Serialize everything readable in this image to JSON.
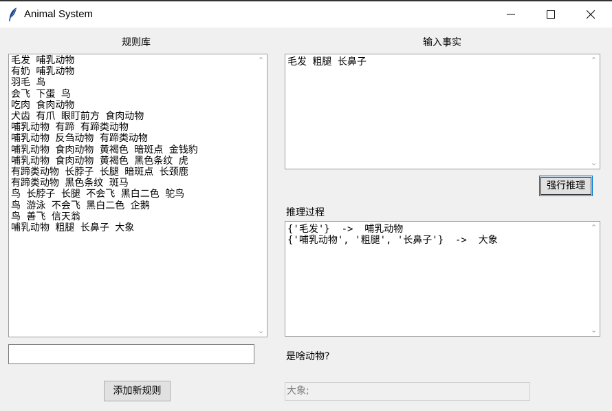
{
  "window": {
    "title": "Animal System"
  },
  "rules": {
    "label": "规则库",
    "lines": [
      "毛发 哺乳动物",
      "有奶 哺乳动物",
      "羽毛 鸟",
      "会飞 下蛋 鸟",
      "吃肉 食肉动物",
      "犬齿 有爪 眼盯前方 食肉动物",
      "哺乳动物 有蹄 有蹄类动物",
      "哺乳动物 反刍动物 有蹄类动物",
      "哺乳动物 食肉动物 黄褐色 暗斑点 金钱豹",
      "哺乳动物 食肉动物 黄褐色 黑色条纹 虎",
      "有蹄类动物 长脖子 长腿 暗斑点 长颈鹿",
      "有蹄类动物 黑色条纹 斑马",
      "鸟 长脖子 长腿 不会飞 黑白二色 鸵鸟",
      "鸟 游泳 不会飞 黑白二色 企鹅",
      "鸟 善飞 信天翁",
      "哺乳动物 粗腿 长鼻子 大象"
    ],
    "new_rule_value": "",
    "add_button": "添加新规则"
  },
  "facts": {
    "label": "输入事实",
    "value": "毛发 粗腿 长鼻子",
    "infer_button": "强行推理"
  },
  "process": {
    "label": "推理过程",
    "lines": [
      "{'毛发'}  ->  哺乳动物",
      "{'哺乳动物', '粗腿', '长鼻子'}  ->  大象"
    ]
  },
  "answer": {
    "label": "是啥动物?",
    "value": "大象;"
  },
  "icons": {
    "app": "feather-icon",
    "minimize": "minimize-icon",
    "maximize": "maximize-icon",
    "close": "close-icon"
  }
}
